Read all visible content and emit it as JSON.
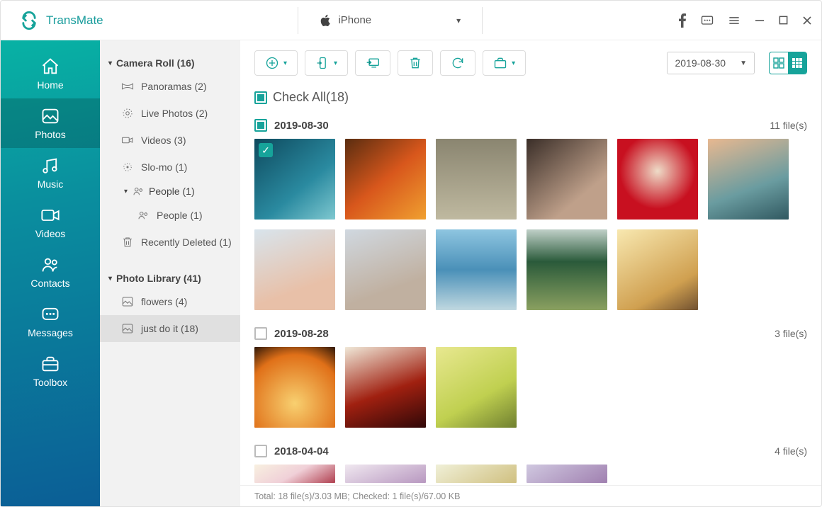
{
  "app": {
    "name": "TransMate"
  },
  "device": {
    "label": "iPhone"
  },
  "nav": {
    "items": [
      {
        "label": "Home"
      },
      {
        "label": "Photos"
      },
      {
        "label": "Music"
      },
      {
        "label": "Videos"
      },
      {
        "label": "Contacts"
      },
      {
        "label": "Messages"
      },
      {
        "label": "Toolbox"
      }
    ]
  },
  "tree": {
    "camera_roll": {
      "label": "Camera Roll (16)"
    },
    "panoramas": {
      "label": "Panoramas (2)"
    },
    "live_photos": {
      "label": "Live Photos (2)"
    },
    "videos": {
      "label": "Videos (3)"
    },
    "slomo": {
      "label": "Slo-mo (1)"
    },
    "people_parent": {
      "label": "People (1)"
    },
    "people_child": {
      "label": "People (1)"
    },
    "recently_deleted": {
      "label": "Recently Deleted (1)"
    },
    "photo_library": {
      "label": "Photo Library (41)"
    },
    "flowers": {
      "label": "flowers (4)"
    },
    "just_do_it": {
      "label": "just do it (18)"
    }
  },
  "toolbar": {
    "date_filter": "2019-08-30"
  },
  "checkall": {
    "label": "Check All(18)"
  },
  "groups": [
    {
      "date": "2019-08-30",
      "count_label": "11 file(s)",
      "checked_state": "sq",
      "thumbs": 11,
      "first_selected": true
    },
    {
      "date": "2019-08-28",
      "count_label": "3 file(s)",
      "checked_state": "empty",
      "thumbs": 3
    },
    {
      "date": "2018-04-04",
      "count_label": "4 file(s)",
      "checked_state": "empty",
      "thumbs": 4,
      "half": true
    }
  ],
  "status": {
    "text": "Total: 18 file(s)/3.03 MB; Checked: 1 file(s)/67.00 KB"
  }
}
